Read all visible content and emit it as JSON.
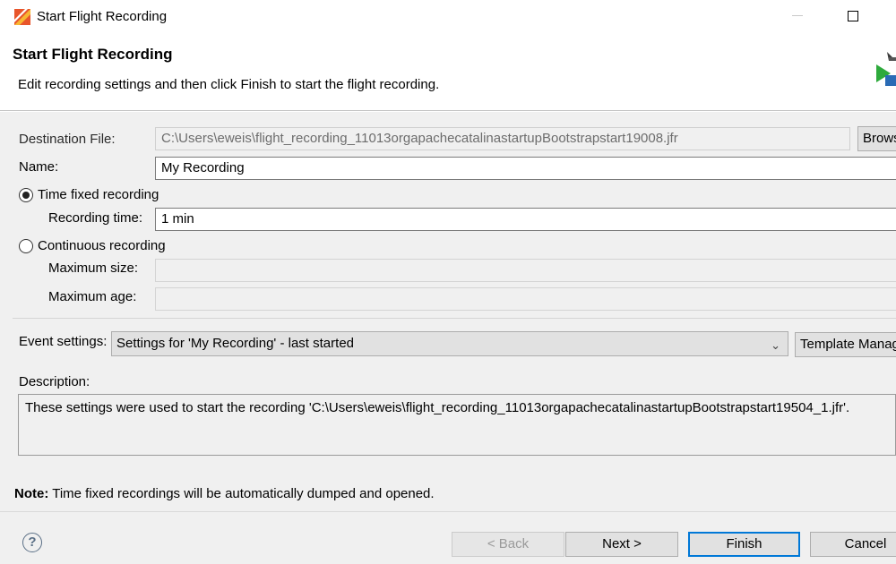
{
  "window": {
    "title": "Start Flight Recording",
    "app_icon": "jmc-flame-icon"
  },
  "header": {
    "title": "Start Flight Recording",
    "subtitle": "Edit recording settings and then click Finish to start the flight recording.",
    "icon": "wizard-recording-icon"
  },
  "form": {
    "destination_label": "Destination File:",
    "destination_value": "C:\\Users\\eweis\\flight_recording_11013orgapachecatalinastartupBootstrapstart19008.jfr",
    "browse_label": "Browse...",
    "name_label": "Name:",
    "name_value": "My Recording",
    "time_fixed_label": "Time fixed recording",
    "time_fixed_selected": true,
    "recording_time_label": "Recording time:",
    "recording_time_value": "1 min",
    "continuous_label": "Continuous recording",
    "continuous_selected": false,
    "max_size_label": "Maximum size:",
    "max_size_value": "",
    "max_age_label": "Maximum age:",
    "max_age_value": "",
    "event_settings_label": "Event settings:",
    "event_settings_value": "Settings for 'My Recording' - last started",
    "template_manager_label": "Template Manager",
    "description_label": "Description:",
    "description_text": "These settings were used to start the recording 'C:\\Users\\eweis\\flight_recording_11013orgapachecatalinastartupBootstrapstart19504_1.jfr'."
  },
  "note": {
    "label": "Note:",
    "text": " Time fixed recordings will be automatically dumped and opened."
  },
  "buttons": {
    "help_glyph": "?",
    "back": "< Back",
    "next": "Next >",
    "finish": "Finish",
    "cancel": "Cancel"
  },
  "colors": {
    "accent": "#0078d7",
    "panel_bg": "#f0f0f0"
  }
}
